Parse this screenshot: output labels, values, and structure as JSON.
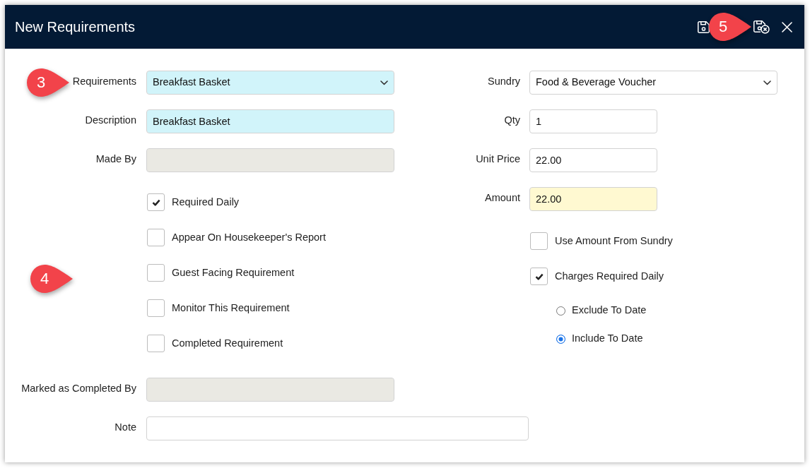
{
  "window": {
    "title": "New Requirements",
    "callout": "5"
  },
  "requirement": {
    "fields": [
      {
        "kind": "select",
        "label": "Requirements",
        "value": "Breakfast Basket",
        "required": true,
        "disabled": false,
        "calculated": false,
        "callout": "3"
      },
      {
        "kind": "text",
        "label": "Description",
        "value": "Breakfast Basket",
        "required": true,
        "disabled": false,
        "calculated": false
      },
      {
        "kind": "text",
        "label": "Made By",
        "required": false,
        "disabled": true,
        "calculated": false
      }
    ],
    "options_callout": "4",
    "options": [
      {
        "label": "Required Daily",
        "checked": true
      },
      {
        "label": "Appear On Housekeeper's Report",
        "checked": false
      },
      {
        "label": "Guest Facing Requirement",
        "checked": false
      },
      {
        "label": "Monitor This Requirement",
        "checked": false
      },
      {
        "label": "Completed Requirement",
        "checked": false
      }
    ]
  },
  "charges": {
    "fields": [
      {
        "kind": "select",
        "label": "Sundry",
        "value": "Food & Beverage Voucher",
        "required": false,
        "disabled": false,
        "calculated": false
      },
      {
        "kind": "text",
        "label": "Qty",
        "value": "1",
        "required": false,
        "disabled": false,
        "calculated": false
      },
      {
        "kind": "text",
        "label": "Unit Price",
        "value": "22.00",
        "required": false,
        "disabled": false,
        "calculated": false
      },
      {
        "kind": "text",
        "label": "Amount",
        "value": "22.00",
        "required": false,
        "disabled": false,
        "calculated": true
      }
    ],
    "options": [
      {
        "label": "Use Amount From Sundry",
        "checked": false
      },
      {
        "label": "Charges Required Daily",
        "checked": true
      }
    ],
    "date_mode": [
      {
        "label": "Exclude To Date",
        "selected": false
      },
      {
        "label": "Include To Date",
        "selected": true
      }
    ]
  },
  "completion": {
    "fields": [
      {
        "kind": "text",
        "label": "Marked as Completed By",
        "required": false,
        "disabled": true,
        "calculated": false
      },
      {
        "kind": "text",
        "label": "Note",
        "required": false,
        "disabled": false,
        "calculated": false
      }
    ]
  }
}
